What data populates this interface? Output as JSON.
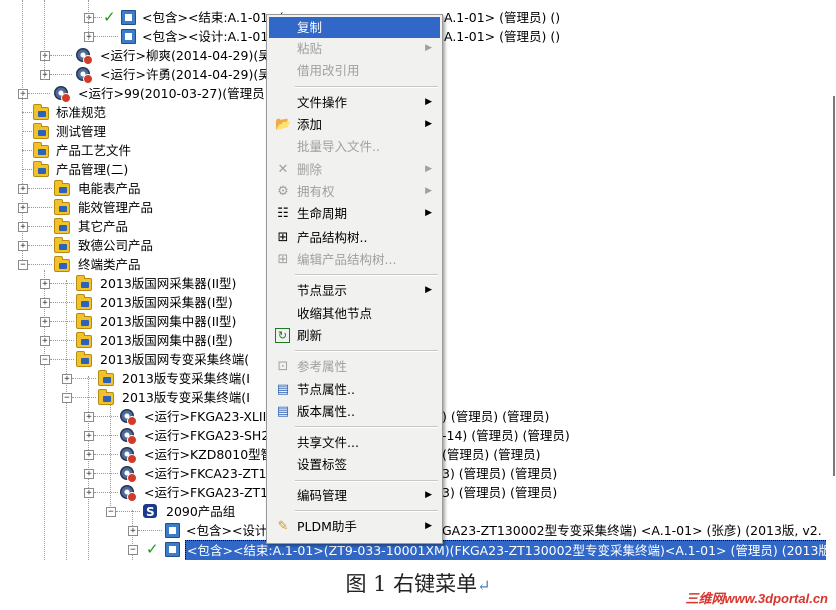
{
  "tree": {
    "rows": [
      {
        "id": "r0",
        "text": "<包含><结束:A.1-01>(",
        "tail": "A.1-01> (管理员) ()"
      },
      {
        "id": "r1",
        "text": "<包含><设计:A.1-01",
        "tail": "A.1-01> (管理员) ()"
      },
      {
        "id": "r2",
        "text": "<运行>柳爽(2014-04-29)(吴"
      },
      {
        "id": "r3",
        "text": "<运行>许勇(2014-04-29)(吴"
      },
      {
        "id": "r4",
        "text": "<运行>99(2010-03-27)(管理员"
      },
      {
        "id": "r5",
        "text": "标准规范"
      },
      {
        "id": "r6",
        "text": "测试管理"
      },
      {
        "id": "r7",
        "text": "产品工艺文件"
      },
      {
        "id": "r8",
        "text": "产品管理(二)"
      },
      {
        "id": "r9",
        "text": "电能表产品"
      },
      {
        "id": "r10",
        "text": "能效管理产品"
      },
      {
        "id": "r11",
        "text": "其它产品"
      },
      {
        "id": "r12",
        "text": "致德公司产品"
      },
      {
        "id": "r13",
        "text": "终端类产品"
      },
      {
        "id": "r14",
        "text": "2013版国网采集器(II型)"
      },
      {
        "id": "r15",
        "text": "2013版国网采集器(I型)"
      },
      {
        "id": "r16",
        "text": "2013版国网集中器(II型)"
      },
      {
        "id": "r17",
        "text": "2013版国网集中器(I型)"
      },
      {
        "id": "r18",
        "text": "2013版国网专变采集终端("
      },
      {
        "id": "r19",
        "text": "2013版专变采集终端(I"
      },
      {
        "id": "r20",
        "text": "2013版专变采集终端(I"
      },
      {
        "id": "r21",
        "text": "<运行>FKGA23-XLIII",
        "tail": ") (管理员) (管理员)"
      },
      {
        "id": "r22",
        "text": "<运行>FKGA23-SH298",
        "tail": "-14) (管理员) (管理员)"
      },
      {
        "id": "r23",
        "text": "<运行>KZD8010型智能",
        "tail": "(管理员) (管理员)"
      },
      {
        "id": "r24",
        "text": "<运行>FKCA23-ZT130",
        "tail": "3) (管理员) (管理员)"
      },
      {
        "id": "r25",
        "text": "<运行>FKGA23-ZT130",
        "tail": "3) (管理员) (管理员)"
      },
      {
        "id": "r26",
        "text": "2090产品组"
      },
      {
        "id": "r27",
        "text": "<包含><设计",
        "tail": "GA23-ZT130002型专变采集终端) <A.1-01> (张彦) (2013版, v2."
      },
      {
        "id": "r28",
        "text": "<包含><结束:A.1-01>(ZT9-033-10001XM)(FKGA23-ZT130002型专变采集终端)<A.1-01> (管理员) (2013版, v"
      }
    ]
  },
  "menu": {
    "items": [
      {
        "label": "复制",
        "state": "highlight",
        "icon": "none",
        "submenu": false
      },
      {
        "label": "粘贴",
        "state": "disabled",
        "icon": "none",
        "submenu": true
      },
      {
        "label": "借用改引用",
        "state": "disabled",
        "icon": "none",
        "submenu": false
      },
      {
        "label": "文件操作",
        "state": "normal",
        "icon": "none",
        "submenu": true
      },
      {
        "label": "添加",
        "state": "normal",
        "icon": "open-folder-icon",
        "submenu": true
      },
      {
        "label": "批量导入文件..",
        "state": "disabled",
        "icon": "none",
        "submenu": false
      },
      {
        "label": "删除",
        "state": "disabled",
        "icon": "delete-x-icon",
        "submenu": true
      },
      {
        "label": "拥有权",
        "state": "disabled",
        "icon": "ownership-icon",
        "submenu": true
      },
      {
        "label": "生命周期",
        "state": "normal",
        "icon": "lifecycle-icon",
        "submenu": true
      },
      {
        "label": "产品结构树..",
        "state": "normal",
        "icon": "structure-tree-icon",
        "submenu": false
      },
      {
        "label": "编辑产品结构树...",
        "state": "disabled",
        "icon": "edit-tree-icon",
        "submenu": false
      },
      {
        "label": "节点显示",
        "state": "normal",
        "icon": "none",
        "submenu": true
      },
      {
        "label": "收缩其他节点",
        "state": "normal",
        "icon": "none",
        "submenu": false
      },
      {
        "label": "刷新",
        "state": "normal",
        "icon": "refresh-icon",
        "submenu": false
      },
      {
        "label": "参考属性",
        "state": "disabled",
        "icon": "reference-icon",
        "submenu": false
      },
      {
        "label": "节点属性..",
        "state": "normal",
        "icon": "node-properties-icon",
        "submenu": false
      },
      {
        "label": "版本属性..",
        "state": "normal",
        "icon": "version-properties-icon",
        "submenu": false
      },
      {
        "label": "共享文件...",
        "state": "normal",
        "icon": "none",
        "submenu": false
      },
      {
        "label": "设置标签",
        "state": "normal",
        "icon": "none",
        "submenu": false
      },
      {
        "label": "编码管理",
        "state": "normal",
        "icon": "none",
        "submenu": true
      },
      {
        "label": "PLDM助手",
        "state": "normal",
        "icon": "assistant-icon",
        "submenu": true
      }
    ]
  },
  "caption": {
    "text": "图 1  右键菜单"
  },
  "watermark": {
    "text": "三维网www.3dportal.cn"
  },
  "colors": {
    "selection": "#3168c8",
    "menu_bg": "#f1f1ef",
    "folder": "#f2c22a",
    "check": "#1b9a1b"
  }
}
